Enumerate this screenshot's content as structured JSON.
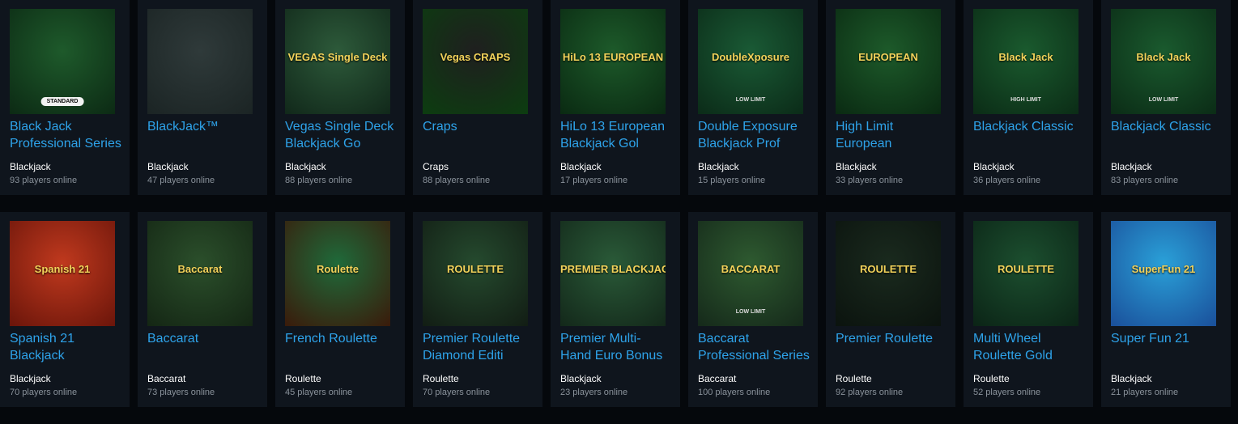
{
  "games": [
    {
      "title_line1": "Black Jack",
      "title_line2": "Professional Series",
      "category": "Blackjack",
      "online": "93 players online",
      "thumb_logo": "",
      "thumb_badge": "STANDARD",
      "thumb_bg": "#1e5a2b",
      "thumb_bg2": "#0c2a14"
    },
    {
      "title_line1": "BlackJack™",
      "title_line2": "",
      "category": "Blackjack",
      "online": "47 players online",
      "thumb_logo": "",
      "thumb_badge": "",
      "thumb_bg": "#2f3a3a",
      "thumb_bg2": "#1b2424"
    },
    {
      "title_line1": "Vegas Single Deck",
      "title_line2": "Blackjack Go",
      "category": "Blackjack",
      "online": "88 players online",
      "thumb_logo": "VEGAS Single Deck",
      "thumb_badge": "",
      "thumb_bg": "#2d5a3a",
      "thumb_bg2": "#11281a"
    },
    {
      "title_line1": "Craps",
      "title_line2": "",
      "category": "Craps",
      "online": "88 players online",
      "thumb_logo": "Vegas CRAPS",
      "thumb_badge": "",
      "thumb_bg": "#1f1f1f",
      "thumb_bg2": "#0c3d10"
    },
    {
      "title_line1": "HiLo 13 European",
      "title_line2": "Blackjack Gol",
      "category": "Blackjack",
      "online": "17 players online",
      "thumb_logo": "HiLo 13 EUROPEAN",
      "thumb_badge": "",
      "thumb_bg": "#1d5a2a",
      "thumb_bg2": "#0a2a12"
    },
    {
      "title_line1": "Double Exposure",
      "title_line2": "Blackjack Prof",
      "category": "Blackjack",
      "online": "15 players online",
      "thumb_logo": "DoubleXposure",
      "thumb_badge": "LOW LIMIT",
      "thumb_bg": "#1a5a35",
      "thumb_bg2": "#0b2b18"
    },
    {
      "title_line1": "High Limit",
      "title_line2": "European",
      "category": "Blackjack",
      "online": "33 players online",
      "thumb_logo": "EUROPEAN",
      "thumb_badge": "",
      "thumb_bg": "#1d5a2a",
      "thumb_bg2": "#0a2a12"
    },
    {
      "title_line1": "Blackjack Classic",
      "title_line2": "",
      "category": "Blackjack",
      "online": "36 players online",
      "thumb_logo": "Black Jack",
      "thumb_badge": "HIGH LIMIT",
      "thumb_bg": "#1a5a2e",
      "thumb_bg2": "#0b2c16"
    },
    {
      "title_line1": "Blackjack Classic",
      "title_line2": "",
      "category": "Blackjack",
      "online": "83 players online",
      "thumb_logo": "Black Jack",
      "thumb_badge": "LOW LIMIT",
      "thumb_bg": "#1a5a2e",
      "thumb_bg2": "#0b2c16"
    }
  ],
  "games_row2": [
    {
      "title_line1": "Spanish 21",
      "title_line2": "Blackjack",
      "category": "Blackjack",
      "online": "70 players online",
      "thumb_logo": "Spanish 21",
      "thumb_badge": "",
      "thumb_bg": "#c0391e",
      "thumb_bg2": "#6a150a"
    },
    {
      "title_line1": "Baccarat",
      "title_line2": "",
      "category": "Baccarat",
      "online": "73 players online",
      "thumb_logo": "Baccarat",
      "thumb_badge": "",
      "thumb_bg": "#2b4f2b",
      "thumb_bg2": "#142614"
    },
    {
      "title_line1": "French Roulette",
      "title_line2": "",
      "category": "Roulette",
      "online": "45 players online",
      "thumb_logo": "Roulette",
      "thumb_badge": "",
      "thumb_bg": "#1f6a3a",
      "thumb_bg2": "#3a1a0a"
    },
    {
      "title_line1": "Premier Roulette",
      "title_line2": "Diamond Editi",
      "category": "Roulette",
      "online": "70 players online",
      "thumb_logo": "ROULETTE",
      "thumb_badge": "",
      "thumb_bg": "#254a2e",
      "thumb_bg2": "#121d14"
    },
    {
      "title_line1": "Premier Multi-",
      "title_line2": "Hand Euro Bonus",
      "category": "Blackjack",
      "online": "23 players online",
      "thumb_logo": "PREMIER BLACKJACK",
      "thumb_badge": "",
      "thumb_bg": "#2a5a38",
      "thumb_bg2": "#13281a"
    },
    {
      "title_line1": "Baccarat",
      "title_line2": "Professional Series",
      "category": "Baccarat",
      "online": "100 players online",
      "thumb_logo": "BACCARAT",
      "thumb_badge": "LOW LIMIT",
      "thumb_bg": "#2e5a30",
      "thumb_bg2": "#15291a"
    },
    {
      "title_line1": "Premier Roulette",
      "title_line2": "",
      "category": "Roulette",
      "online": "92 players online",
      "thumb_logo": "ROULETTE",
      "thumb_badge": "",
      "thumb_bg": "#1a2a1e",
      "thumb_bg2": "#0b130e"
    },
    {
      "title_line1": "Multi Wheel",
      "title_line2": "Roulette Gold",
      "category": "Roulette",
      "online": "52 players online",
      "thumb_logo": "ROULETTE",
      "thumb_badge": "",
      "thumb_bg": "#1c4f2f",
      "thumb_bg2": "#0b2416"
    },
    {
      "title_line1": "Super Fun 21",
      "title_line2": "",
      "category": "Blackjack",
      "online": "21 players online",
      "thumb_logo": "SuperFun 21",
      "thumb_badge": "",
      "thumb_bg": "#2aa0d8",
      "thumb_bg2": "#1a4f9a"
    }
  ],
  "colors": {
    "title": "#2ea3ea",
    "category": "#ffffff",
    "online": "#8a929b",
    "card_bg": "#0f151d",
    "page_bg": "#05080c"
  }
}
